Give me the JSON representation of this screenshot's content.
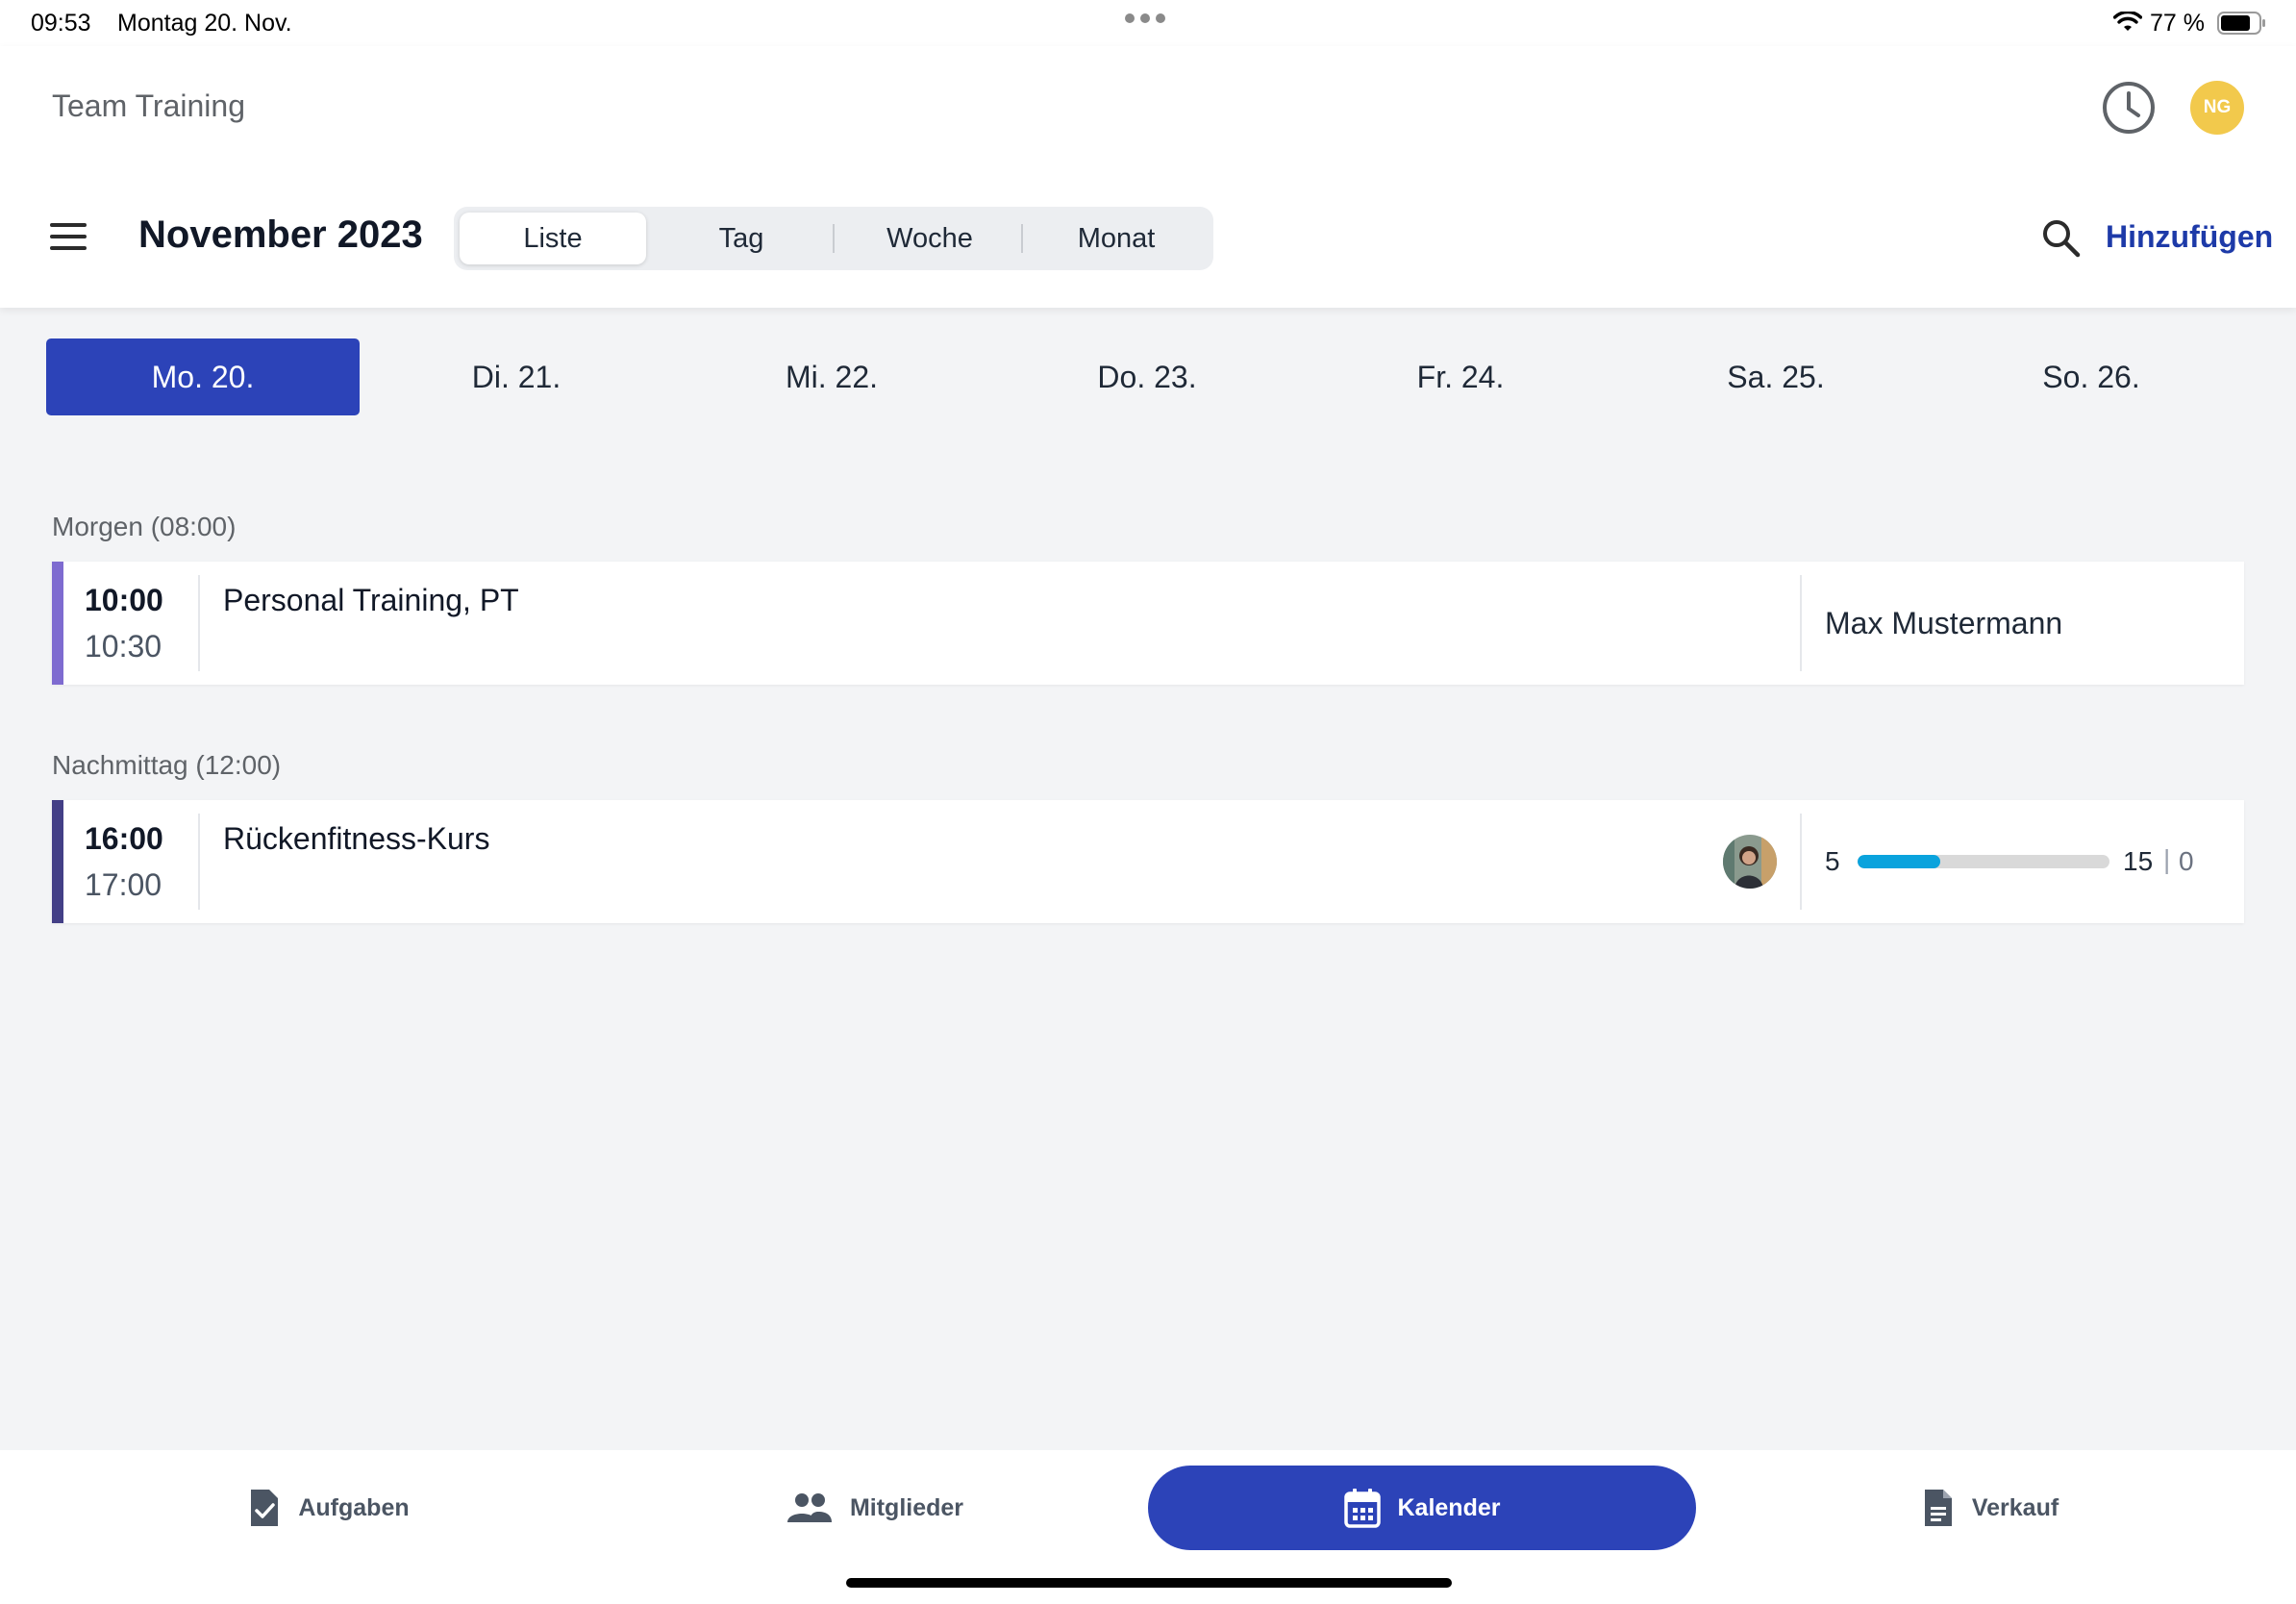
{
  "status_bar": {
    "time": "09:53",
    "date": "Montag 20. Nov.",
    "battery": "77 %"
  },
  "header": {
    "app_title": "Team Training",
    "avatar_initials": "NG",
    "avatar_color": "#f2c94c",
    "month_title": "November 2023",
    "add_label": "Hinzufügen",
    "view_tabs": [
      {
        "label": "Liste",
        "active": true
      },
      {
        "label": "Tag",
        "active": false
      },
      {
        "label": "Woche",
        "active": false
      },
      {
        "label": "Monat",
        "active": false
      }
    ]
  },
  "days": [
    {
      "label": "Mo. 20.",
      "active": true
    },
    {
      "label": "Di. 21.",
      "active": false
    },
    {
      "label": "Mi. 22.",
      "active": false
    },
    {
      "label": "Do. 23.",
      "active": false
    },
    {
      "label": "Fr. 24.",
      "active": false
    },
    {
      "label": "Sa. 25.",
      "active": false
    },
    {
      "label": "So. 26.",
      "active": false
    }
  ],
  "sections": [
    {
      "label": "Morgen (08:00)",
      "events": [
        {
          "start": "10:00",
          "end": "10:30",
          "title": "Personal Training, PT",
          "trainer": "Max Mustermann",
          "accent_color": "#7e6bd0"
        }
      ]
    },
    {
      "label": "Nachmittag (12:00)",
      "events": [
        {
          "start": "16:00",
          "end": "17:00",
          "title": "Rückenfitness-Kurs",
          "accent_color": "#433f86",
          "capacity": {
            "booked": "5",
            "max": "15",
            "separator": "|",
            "waitlist": "0",
            "fill_fraction": 0.33,
            "fill_color": "#0aa3dd"
          }
        }
      ]
    }
  ],
  "bottom_nav": [
    {
      "label": "Aufgaben",
      "icon": "task-check-icon",
      "active": false
    },
    {
      "label": "Mitglieder",
      "icon": "people-icon",
      "active": false
    },
    {
      "label": "Kalender",
      "icon": "calendar-icon",
      "active": true
    },
    {
      "label": "Verkauf",
      "icon": "document-icon",
      "active": false
    }
  ],
  "colors": {
    "primary": "#2c43b8",
    "link": "#1d3aa8",
    "background": "#f3f4f6"
  }
}
